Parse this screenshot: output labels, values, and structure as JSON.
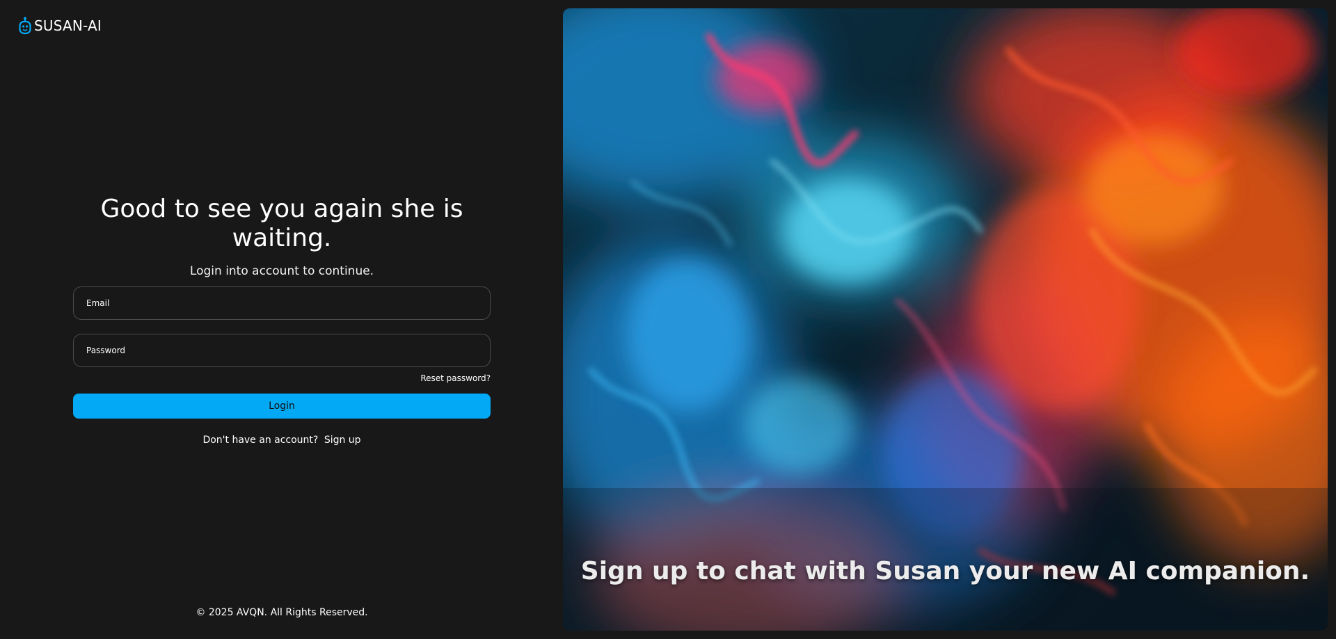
{
  "brand": {
    "name": "SUSAN-AI",
    "icon": "robot-icon",
    "icon_color": "#03a9f4"
  },
  "auth": {
    "headline": "Good to see you again she is waiting.",
    "subtitle": "Login into account to continue.",
    "email_placeholder": "Email",
    "password_placeholder": "Password",
    "reset_label": "Reset password?",
    "login_label": "Login",
    "signup_prompt": "Don't have an account?",
    "signup_label": "Sign up"
  },
  "footer": {
    "copyright": "© 2025 AVQN. All Rights Reserved."
  },
  "hero": {
    "caption": "Sign up to chat with Susan your new AI companion.",
    "image": "abstract-ink-smoke-image"
  },
  "colors": {
    "background": "#181818",
    "accent": "#03a9f4",
    "field_border": "#4a4a4a"
  }
}
